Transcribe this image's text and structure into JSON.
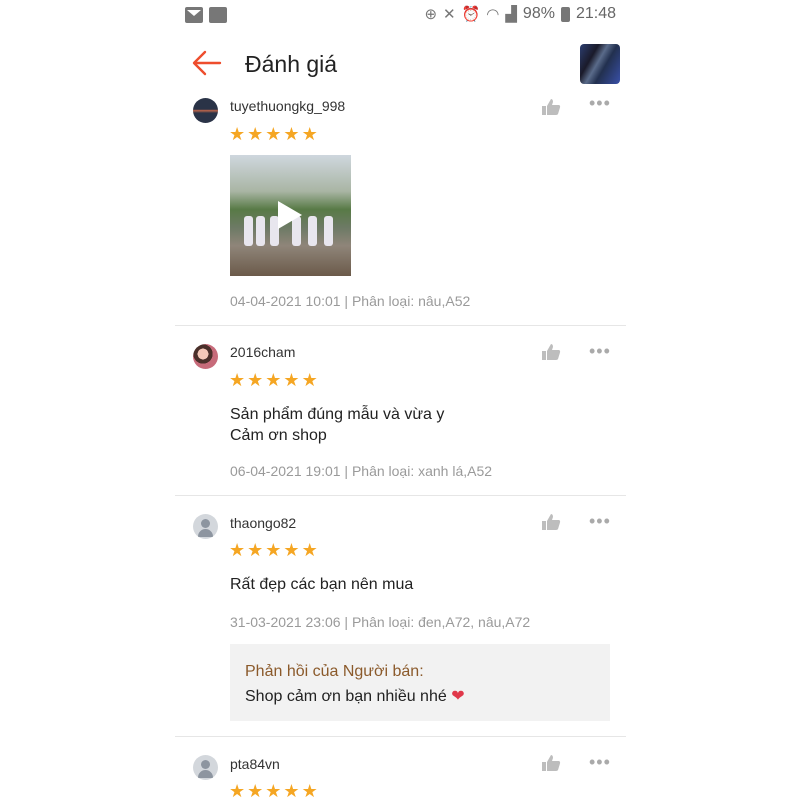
{
  "status_bar": {
    "battery": "98%",
    "time": "21:48"
  },
  "header": {
    "title": "Đánh giá"
  },
  "reviews": [
    {
      "username": "tuyethuongkg_998",
      "rating": 5,
      "comment_lines": [],
      "meta": "04-04-2021 10:01 | Phân loại: nâu,A52",
      "has_video": true
    },
    {
      "username": "2016cham",
      "rating": 5,
      "comment_lines": [
        "Sản phẩm đúng mẫu và vừa y",
        "Cảm ơn shop"
      ],
      "meta": "06-04-2021 19:01 | Phân loại: xanh lá,A52"
    },
    {
      "username": "thaongo82",
      "rating": 5,
      "comment_lines": [
        "Rất đẹp  các bạn nên mua"
      ],
      "meta": "31-03-2021 23:06 | Phân loại: đen,A72, nâu,A72",
      "seller_reply": {
        "label": "Phản hồi của Người bán:",
        "text": "Shop cảm ơn bạn nhiều nhé"
      }
    },
    {
      "username": "pta84vn",
      "rating": 5,
      "comment_lines": [],
      "meta": ""
    }
  ],
  "icons": {
    "back": "arrow-left-icon",
    "like": "thumbs-up-icon",
    "more": "more-dots-icon",
    "star": "star-icon",
    "play": "play-icon",
    "heart": "heart-icon"
  },
  "colors": {
    "accent": "#ee4d2d",
    "star": "#f5a623",
    "reply_label": "#8b5a2b"
  }
}
